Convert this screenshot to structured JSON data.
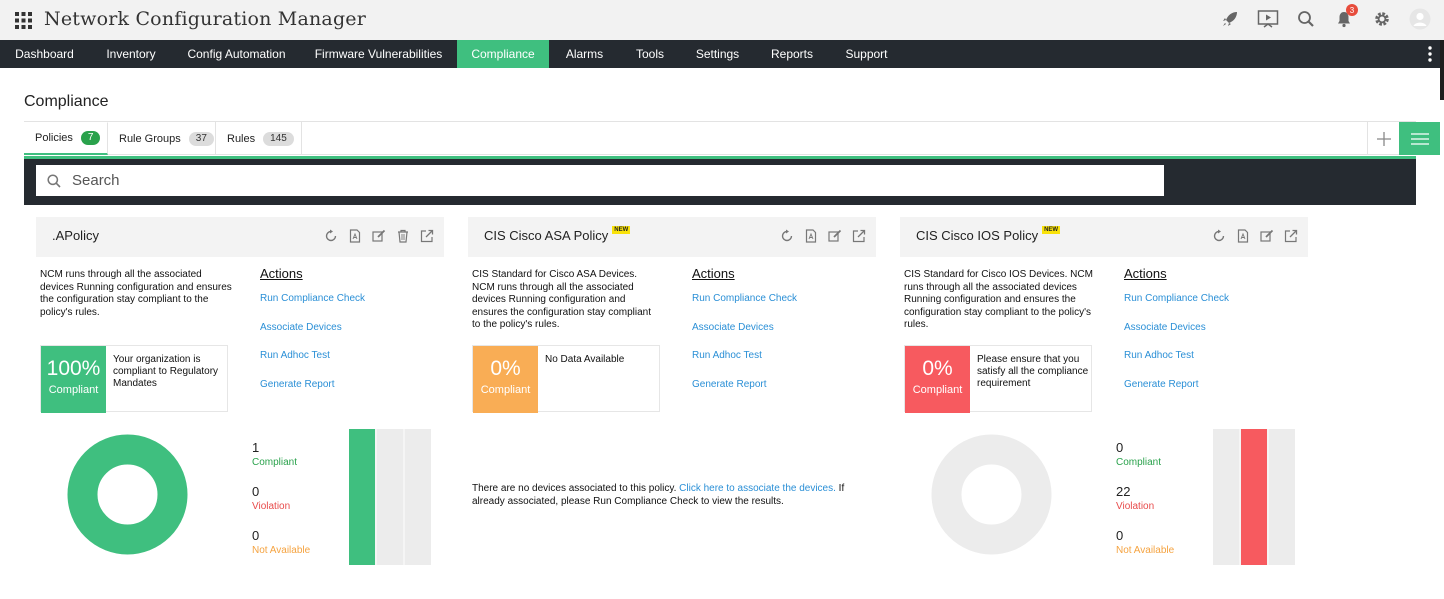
{
  "app": {
    "title": "Network Configuration Manager",
    "notification_count": "3"
  },
  "nav": [
    {
      "label": "Dashboard"
    },
    {
      "label": "Inventory"
    },
    {
      "label": "Config Automation"
    },
    {
      "label": "Firmware Vulnerabilities"
    },
    {
      "label": "Compliance"
    },
    {
      "label": "Alarms"
    },
    {
      "label": "Tools"
    },
    {
      "label": "Settings"
    },
    {
      "label": "Reports"
    },
    {
      "label": "Support"
    }
  ],
  "active_nav": "Compliance",
  "page": {
    "title": "Compliance"
  },
  "tabs": [
    {
      "label": "Policies",
      "count": "7"
    },
    {
      "label": "Rule Groups",
      "count": "37"
    },
    {
      "label": "Rules",
      "count": "145"
    }
  ],
  "search": {
    "placeholder": "Search"
  },
  "actions_title": "Actions",
  "actions": [
    "Run Compliance Check",
    "Associate Devices",
    "Run Adhoc Test",
    "Generate Report"
  ],
  "new_badge": "NEW",
  "colors": {
    "green": "#3fbf7f",
    "orange": "#f9ad55",
    "red": "#f75a5f",
    "grey": "#ececec",
    "link": "#2a8fd6"
  },
  "cards": [
    {
      "title": ".APolicy",
      "is_new": false,
      "description": "NCM runs through all the associated devices Running configuration and ensures the configuration stay compliant to the policy's rules.",
      "score": "100%",
      "score_label": "Compliant",
      "score_message": "Your organization is compliant to Regulatory Mandates",
      "stats": [
        {
          "value": "1",
          "label": "Compliant"
        },
        {
          "value": "0",
          "label": "Violation"
        },
        {
          "value": "0",
          "label": "Not Available"
        }
      ]
    },
    {
      "title": "CIS Cisco ASA Policy",
      "is_new": true,
      "description": "CIS Standard for Cisco ASA Devices. NCM runs through all the associated devices Running configuration and ensures the configuration stay compliant to the policy's rules.",
      "score": "0%",
      "score_label": "Compliant",
      "score_message": "No Data Available",
      "no_devices_text": "There are no devices associated to this policy. ",
      "no_devices_link": "Click here to associate the devices.",
      "no_devices_tail": " If already associated, please Run Compliance Check to view the results."
    },
    {
      "title": "CIS Cisco IOS Policy",
      "is_new": true,
      "description": "CIS Standard for Cisco IOS Devices. NCM runs through all the associated devices Running configuration and ensures the configuration stay compliant to the policy's rules.",
      "score": "0%",
      "score_label": "Compliant",
      "score_message": "Please ensure that you satisfy all the compliance requirement",
      "stats": [
        {
          "value": "0",
          "label": "Compliant"
        },
        {
          "value": "22",
          "label": "Violation"
        },
        {
          "value": "0",
          "label": "Not Available"
        }
      ]
    }
  ]
}
